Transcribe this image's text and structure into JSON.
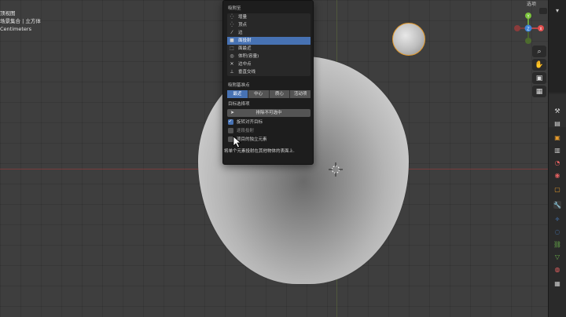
{
  "viewport": {
    "header_info": [
      "顶视图",
      "场景集合 | 立方体",
      "Centimeters"
    ]
  },
  "topright": {
    "label": "选项"
  },
  "snap_menu": {
    "section_snap_to": "吸附至",
    "snap_to_items": [
      {
        "icon": "increment-icon",
        "glyph": "⁛",
        "label": "增量"
      },
      {
        "icon": "vertex-icon",
        "glyph": "⁛",
        "label": "顶点"
      },
      {
        "icon": "edge-icon",
        "glyph": "⁄",
        "label": "边"
      },
      {
        "icon": "face-project-icon",
        "glyph": "■",
        "label": "面投射"
      },
      {
        "icon": "face-nearest-icon",
        "glyph": "⬚",
        "label": "面最近"
      },
      {
        "icon": "volume-icon",
        "glyph": "◎",
        "label": "体积(容量)"
      },
      {
        "icon": "edge-center-icon",
        "glyph": "✕",
        "label": "边中点"
      },
      {
        "icon": "edge-perp-icon",
        "glyph": "⊥",
        "label": "垂直交线"
      }
    ],
    "selected_index": 3,
    "section_snap_with": "吸附基准点",
    "snap_with_options": [
      "最近",
      "中心",
      "质心",
      "活动项"
    ],
    "active_snap_with": 0,
    "section_target": "目标选择项",
    "target_button": "排除不可选中",
    "checkboxes": [
      {
        "label": "旋转对齐目标",
        "checked": true,
        "dim": false
      },
      {
        "label": "逐段投射",
        "checked": false,
        "dim": true
      },
      {
        "label": "项目的独立元素",
        "checked": false,
        "dim": false
      }
    ],
    "tooltip": "将单个元素投射在其他物体的表面上."
  },
  "colors": {
    "accent": "#4772b3",
    "active_outline": "#e39a2d",
    "gizmo_x": "#e04a4a",
    "gizmo_y": "#7ac23b",
    "gizmo_z": "#3d83d6"
  }
}
